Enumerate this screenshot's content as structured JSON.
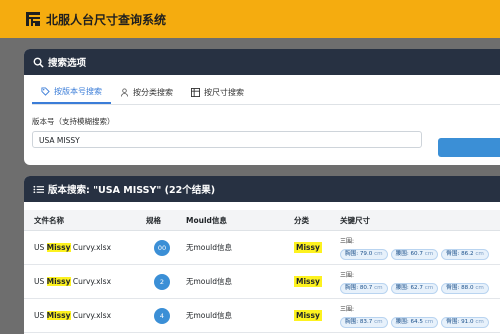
{
  "app": {
    "title": "北服人台尺寸查询系统"
  },
  "search_card": {
    "title": "搜索选项",
    "tabs": [
      {
        "label": "按版本号搜索",
        "active": true
      },
      {
        "label": "按分类搜索",
        "active": false
      },
      {
        "label": "按尺寸搜索",
        "active": false
      }
    ],
    "field_label": "版本号（支持模糊搜索）",
    "field_value": "USA MISSY"
  },
  "results_card": {
    "title": "版本搜索: \"USA MISSY\" (22个结果)",
    "columns": {
      "file": "文件名称",
      "scale": "规格",
      "mould": "Mould信息",
      "category": "分类",
      "sizes": "关键尺寸"
    },
    "rows": [
      {
        "file_prefix": "US ",
        "file_hl": "Missy",
        "file_suffix": " Curvy.xlsx",
        "scale": "00",
        "mould": "无mould信息",
        "category": "Missy",
        "sizes_label": "三围:",
        "chest": "胸围: 79.0",
        "waist": "腰围: 60.7",
        "hip": "臀围: 86.2",
        "unit": "cm"
      },
      {
        "file_prefix": "US ",
        "file_hl": "Missy",
        "file_suffix": " Curvy.xlsx",
        "scale": "2",
        "mould": "无mould信息",
        "category": "Missy",
        "sizes_label": "三围:",
        "chest": "胸围: 80.7",
        "waist": "腰围: 62.7",
        "hip": "臀围: 88.0",
        "unit": "cm"
      },
      {
        "file_prefix": "US ",
        "file_hl": "Missy",
        "file_suffix": " Curvy.xlsx",
        "scale": "4",
        "mould": "无mould信息",
        "category": "Missy",
        "sizes_label": "三围:",
        "chest": "胸围: 83.7",
        "waist": "腰围: 64.5",
        "hip": "臀围: 91.0",
        "unit": "cm"
      }
    ]
  },
  "colors": {
    "accent": "#f5ac0f",
    "header_bg": "#273142",
    "primary": "#3b8fd6",
    "highlight": "#fdf21f"
  }
}
